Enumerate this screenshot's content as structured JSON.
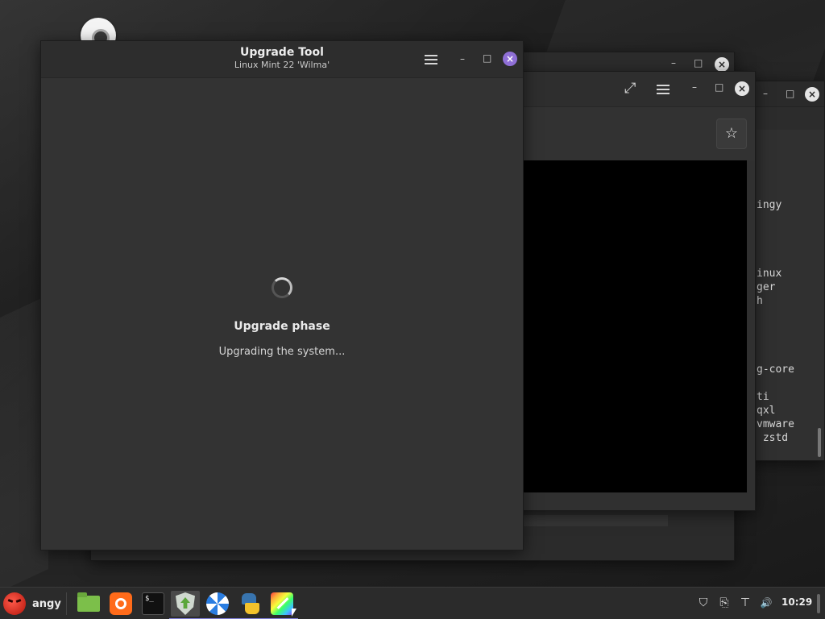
{
  "main_window": {
    "title": "Upgrade Tool",
    "subtitle": "Linux Mint 22 'Wilma'",
    "phase_title": "Upgrade phase",
    "phase_status": "Upgrading the system..."
  },
  "background_terminal": {
    "lines": [
      "",
      "",
      "",
      "",
      "",
      "ingy",
      "",
      "",
      "",
      "",
      "inux",
      "ger",
      "h",
      "",
      "",
      "",
      "",
      "g-core",
      "",
      "ti",
      "qxl",
      "vmware",
      " zstd"
    ]
  },
  "taskbar": {
    "menu_label": "angy",
    "launchers": [
      {
        "name": "file-manager"
      },
      {
        "name": "firefox"
      },
      {
        "name": "terminal",
        "glyph": "$_"
      },
      {
        "name": "update-manager"
      },
      {
        "name": "software-manager"
      },
      {
        "name": "python"
      },
      {
        "name": "drawing-app"
      }
    ],
    "clock": "10:29"
  },
  "icons": {
    "maximize": "□",
    "minimize": "–",
    "close": "×",
    "star": "☆",
    "expand": "⤢",
    "shield": "⛉",
    "clipboard": "⎘",
    "network": "⊤",
    "volume": "🔊"
  }
}
